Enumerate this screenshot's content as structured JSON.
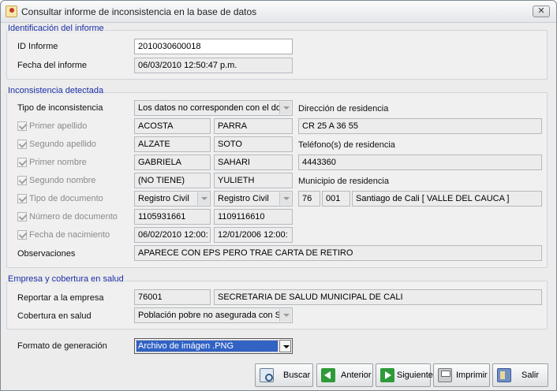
{
  "window": {
    "title": "Consultar informe de inconsistencia en la base de datos",
    "close_label": "✕"
  },
  "identificacion": {
    "title": "Identificación del informe",
    "id_label": "ID Informe",
    "id_value": "2010030600018",
    "fecha_label": "Fecha del informe",
    "fecha_value": "06/03/2010 12:50:47 p.m."
  },
  "inconsistencia": {
    "title": "Inconsistencia detectada",
    "tipo_label": "Tipo de inconsistencia",
    "tipo_value": "Los datos no corresponden con el do",
    "primer_apellido_label": "Primer apellido",
    "primer_apellido_a": "ACOSTA",
    "primer_apellido_b": "PARRA",
    "segundo_apellido_label": "Segundo apellido",
    "segundo_apellido_a": "ALZATE",
    "segundo_apellido_b": "SOTO",
    "primer_nombre_label": "Primer nombre",
    "primer_nombre_a": "GABRIELA",
    "primer_nombre_b": "SAHARI",
    "segundo_nombre_label": "Segundo nombre",
    "segundo_nombre_a": "(NO TIENE)",
    "segundo_nombre_b": "YULIETH",
    "tipo_doc_label": "Tipo de documento",
    "tipo_doc_a": "Registro Civil",
    "tipo_doc_b": "Registro Civil",
    "numero_doc_label": "Número de documento",
    "numero_doc_a": "1105931661",
    "numero_doc_b": "1109116610",
    "fecha_nac_label": "Fecha de nacimiento",
    "fecha_nac_a": "06/02/2010 12:00:",
    "fecha_nac_b": "12/01/2006 12:00:",
    "observaciones_label": "Observaciones",
    "observaciones_value": "APARECE CON EPS PERO TRAE CARTA  DE RETIRO",
    "direccion_label": "Dirección de residencia",
    "direccion_value": "CR 25 A 36 55",
    "telefono_label": "Teléfono(s) de residencia",
    "telefono_value": "4443360",
    "municipio_label": "Municipio de residencia",
    "municipio_dep": "76",
    "municipio_cod": "001",
    "municipio_nombre": "Santiago de Cali [ VALLE DEL CAUCA ]"
  },
  "empresa": {
    "title": "Empresa y cobertura en salud",
    "reportar_label": "Reportar a la empresa",
    "reportar_codigo": "76001",
    "reportar_nombre": "SECRETARIA DE SALUD MUNICIPAL DE CALI",
    "cobertura_label": "Cobertura en salud",
    "cobertura_value": "Población pobre no asegurada con SI"
  },
  "formato": {
    "label": "Formato de generación",
    "value": "Archivo de imágen .PNG"
  },
  "buttons": {
    "buscar": "Buscar",
    "anterior": "Anterior",
    "siguiente": "Siguiente",
    "imprimir": "Imprimir",
    "salir": "Salir"
  }
}
